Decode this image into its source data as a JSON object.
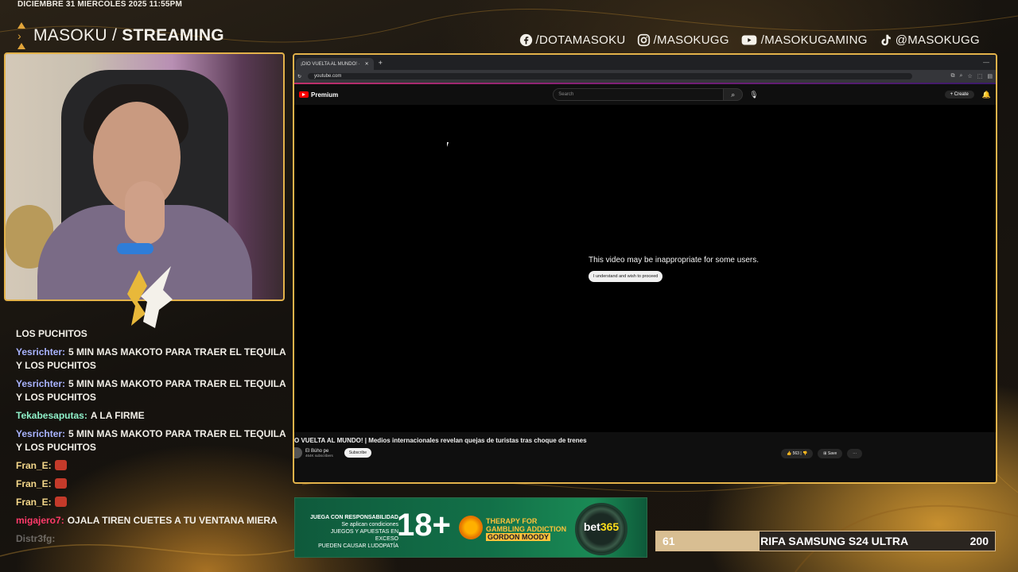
{
  "overlay": {
    "datetime": "DICIEMBRE 31 MIERCOLES 2025 11:55PM",
    "brand_prefix": "MASOKU /",
    "brand_suffix": "STREAMING",
    "socials": [
      {
        "icon": "facebook-icon",
        "label": "/DOTAMASOKU"
      },
      {
        "icon": "instagram-icon",
        "label": "/MASOKUGG"
      },
      {
        "icon": "youtube-icon",
        "label": "/MASOKUGAMING"
      },
      {
        "icon": "tiktok-icon",
        "label": "@MASOKUGG"
      }
    ],
    "accent_color": "#e3b24a"
  },
  "chat": {
    "messages": [
      {
        "user": "",
        "user_color": "#f2efe8",
        "text": "LOS PUCHITOS"
      },
      {
        "user": "Yesrichter:",
        "user_color": "#a9b4ff",
        "text": "5 MIN MAS MAKOTO PARA TRAER EL TEQUILA Y LOS PUCHITOS"
      },
      {
        "user": "Yesrichter:",
        "user_color": "#a9b4ff",
        "text": "5 MIN MAS MAKOTO PARA TRAER EL TEQUILA Y LOS PUCHITOS"
      },
      {
        "user": "Tekabesaputas:",
        "user_color": "#8ff0c9",
        "text": "A LA FIRME"
      },
      {
        "user": "Yesrichter:",
        "user_color": "#a9b4ff",
        "text": "5 MIN MAS MAKOTO PARA TRAER EL TEQUILA Y LOS PUCHITOS"
      },
      {
        "user": "Fran_E:",
        "user_color": "#f4d78a",
        "text": "",
        "emote": true
      },
      {
        "user": "Fran_E:",
        "user_color": "#f4d78a",
        "text": "",
        "emote": true
      },
      {
        "user": "Fran_E:",
        "user_color": "#f4d78a",
        "text": "",
        "emote": true
      },
      {
        "user": "migajero7:",
        "user_color": "#ff3a6a",
        "text": "OJALA TIREN CUETES A TU VENTANA MIERA"
      },
      {
        "user": "Distr3fg:",
        "user_color": "#ffffff",
        "text": "",
        "faded": true
      }
    ]
  },
  "browser": {
    "tab_title": "¡DIO VUELTA AL MUNDO! ·",
    "url": "youtube.com",
    "yt_logo": "Premium",
    "search_placeholder": "Search",
    "create_label": "Create",
    "warning_text": "This video may be inappropriate for some users.",
    "proceed_label": "I understand and wish to proceed",
    "video_title": "O VUELTA AL MUNDO! | Medios internacionales revelan quejas de turistas tras choque de trenes",
    "channel_name": "El Búho pe",
    "channel_subs": "464K subscribers",
    "subscribe_label": "Subscribe",
    "like_count": "563",
    "save_label": "Save"
  },
  "ad": {
    "line1": "JUEGA CON RESPONSABILIDAD",
    "line2": "Se aplican condiciones",
    "line3": "JUEGOS Y APUESTAS EN EXCESO",
    "line4": "PUEDEN CAUSAR LUDOPATÍA",
    "age": "18+",
    "therapy1": "THERAPY FOR",
    "therapy2": "GAMBLING ADDICTION",
    "therapy3": "GORDON MOODY",
    "brand_main": "bet",
    "brand_num": "365"
  },
  "raffle": {
    "current": "61",
    "title": "RIFA SAMSUNG S24 ULTRA",
    "goal": "200",
    "progress_fraction": 0.305
  }
}
